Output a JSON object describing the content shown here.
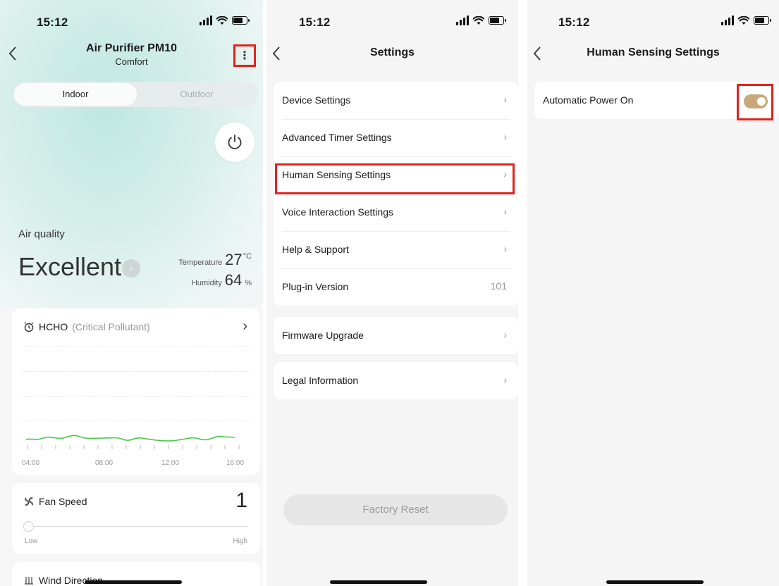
{
  "colors": {
    "accent_red": "#e0231c",
    "toggle_on": "#c8a77a",
    "chart_line": "#4cc64a"
  },
  "panel1": {
    "status_time": "15:12",
    "title": "Air Purifier PM10",
    "subtitle": "Comfort",
    "tabs": [
      "Indoor",
      "Outdoor"
    ],
    "air_quality_label": "Air quality",
    "air_quality_value": "Excellent",
    "temperature_label": "Temperature",
    "temperature_value": "27",
    "temperature_unit": "°C",
    "humidity_label": "Humidity",
    "humidity_value": "64",
    "humidity_unit": "%",
    "hcho_title": "HCHO",
    "hcho_note": "(Critical Pollutant)",
    "chart_ticks": [
      "04:00",
      "08:00",
      "12:00",
      "16:00"
    ],
    "fan_title": "Fan Speed",
    "fan_value": "1",
    "fan_low": "Low",
    "fan_high": "High",
    "fan_level_fraction": 0.0,
    "wind_title": "Wind Direction"
  },
  "panel2": {
    "status_time": "15:12",
    "title": "Settings",
    "group1": [
      {
        "label": "Device Settings",
        "right": ""
      },
      {
        "label": "Advanced Timer Settings",
        "right": ""
      },
      {
        "label": "Human Sensing Settings",
        "right": ""
      },
      {
        "label": "Voice Interaction Settings",
        "right": ""
      },
      {
        "label": "Help & Support",
        "right": ""
      },
      {
        "label": "Plug-in Version",
        "right": "101"
      }
    ],
    "group2": [
      {
        "label": "Firmware Upgrade"
      }
    ],
    "group3": [
      {
        "label": "Legal Information"
      }
    ],
    "factory_reset": "Factory Reset"
  },
  "panel3": {
    "status_time": "15:12",
    "title": "Human Sensing Settings",
    "auto_power_label": "Automatic Power On",
    "auto_power_on": true
  }
}
